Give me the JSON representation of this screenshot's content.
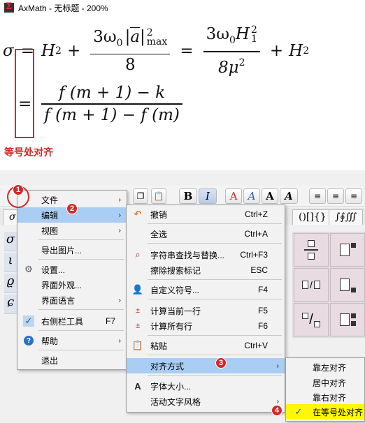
{
  "title": "AxMath - 无标题 - 200%",
  "annotation_label": "等号处对齐",
  "math": {
    "row1": {
      "lhs": "σ",
      "eq": "=",
      "h2a": "H",
      "h2a_sub": "2",
      "plus1": "+",
      "num1": "3ω",
      "num1_sub": "0",
      "abar": "a",
      "abs_sup": "2",
      "abs_sub": "max",
      "den1": "8",
      "eq2": "=",
      "num2": "3ω",
      "num2_sub": "0",
      "h1": "H",
      "h1_sub": "1",
      "h1_sup": "2",
      "den2": "8μ",
      "den2_sup": "2",
      "plus2": "+",
      "h2b": "H",
      "h2b_sub": "2"
    },
    "row2": {
      "eq": "=",
      "num": "f (m + 1) − k",
      "den": "f (m + 1) − f (m)"
    }
  },
  "toolbar": {
    "bold": "B",
    "italic": "I",
    "fmt_a1": "A",
    "fmt_a2": "A",
    "fmt_a3": "A",
    "fmt_a4": "A"
  },
  "tabs": {
    "left": "σ",
    "mid": "()[]{}",
    "right": "∫∮∭"
  },
  "left_symbols": [
    "σ",
    "ι",
    "ϱ",
    "ɕ"
  ],
  "main_menu": {
    "items": [
      {
        "label": "文件",
        "arrow": "›"
      },
      {
        "label": "编辑",
        "arrow": "›"
      },
      {
        "label": "视图",
        "arrow": "›"
      },
      {
        "label": "导出图片..."
      },
      {
        "label": "设置..."
      },
      {
        "label": "界面外观..."
      },
      {
        "label": "界面语言",
        "arrow": "›"
      },
      {
        "label": "右侧栏工具",
        "shortcut": "F7"
      },
      {
        "label": "帮助",
        "arrow": "›"
      },
      {
        "label": "退出"
      }
    ]
  },
  "edit_menu": {
    "items": [
      {
        "label": "撤销",
        "shortcut": "Ctrl+Z"
      },
      {
        "label": "全选",
        "shortcut": "Ctrl+A"
      },
      {
        "label": "字符串查找与替换...",
        "shortcut": "Ctrl+F3"
      },
      {
        "label": "擦除搜索标记",
        "shortcut": "ESC"
      },
      {
        "label": "自定义符号...",
        "shortcut": "F4"
      },
      {
        "label": "计算当前一行",
        "shortcut": "F5"
      },
      {
        "label": "计算所有行",
        "shortcut": "F6"
      },
      {
        "label": "粘贴",
        "shortcut": "Ctrl+V"
      },
      {
        "label": "对齐方式",
        "arrow": "›"
      },
      {
        "label": "字体大小..."
      },
      {
        "label": "活动文字风格",
        "arrow": "›"
      }
    ]
  },
  "align_menu": {
    "items": [
      {
        "label": "靠左对齐"
      },
      {
        "label": "居中对齐"
      },
      {
        "label": "靠右对齐"
      },
      {
        "label": "在等号处对齐"
      }
    ]
  },
  "steps": [
    "1",
    "2",
    "3",
    "4"
  ],
  "colors": {
    "accent": "#d62828",
    "highlight": "#a9cdf3",
    "yellow": "#fff800"
  }
}
